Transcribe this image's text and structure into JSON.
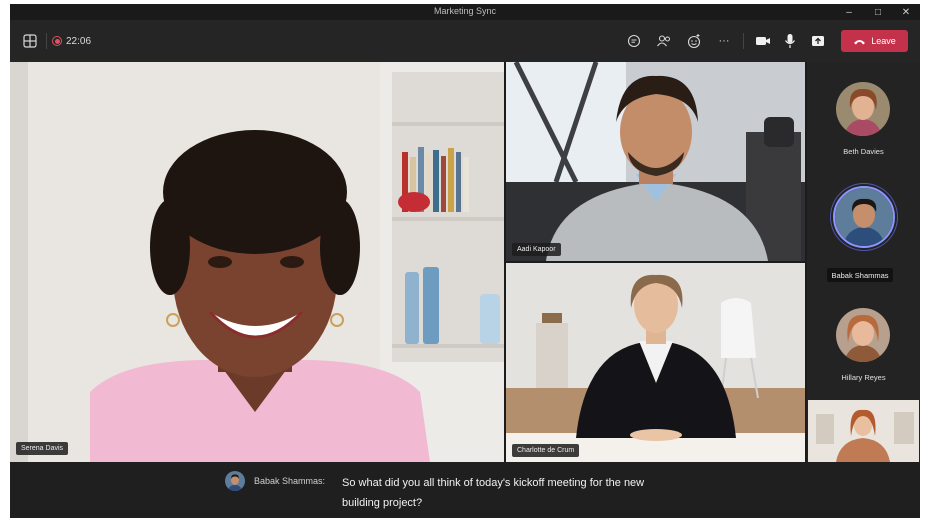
{
  "window": {
    "title": "Marketing Sync"
  },
  "window_controls": {
    "minimize": "–",
    "maximize": "□",
    "close": "✕"
  },
  "toolbar": {
    "timer": "22:06",
    "leave_label": "Leave",
    "icons": [
      "grid-icon",
      "record-icon",
      "chat-icon",
      "people-icon",
      "react-icon",
      "more-icon",
      "camera-icon",
      "mic-icon",
      "share-icon",
      "phone-icon"
    ]
  },
  "participants": {
    "main": "Serena Davis",
    "top_right": "Aadi Kapoor",
    "bottom_right": "Charlotte de Crum"
  },
  "roster": [
    {
      "name": "Beth Davies",
      "speaking": false
    },
    {
      "name": "Babak Shammas",
      "speaking": true
    },
    {
      "name": "Hillary Reyes",
      "speaking": false
    }
  ],
  "caption": {
    "speaker": "Babak Shammas:",
    "line1": "So what did you all think of today's kickoff meeting for the new",
    "line2": "building project?"
  },
  "colors": {
    "accent_leave": "#c4314b",
    "recording": "#e05260",
    "speaking_ring": "#8e95ff"
  }
}
